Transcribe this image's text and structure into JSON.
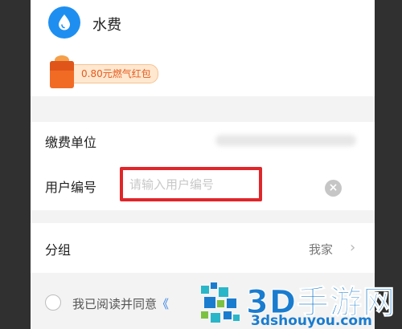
{
  "header": {
    "title": "水费",
    "app_icon": "water-drop-icon"
  },
  "promo": {
    "label": "0.80元燃气红包",
    "icon": "red-envelope-icon"
  },
  "form": {
    "unit_label": "缴费单位",
    "user_no_label": "用户编号",
    "user_no_placeholder": "请输入用户编号",
    "user_no_value": "",
    "clear_icon": "clear-icon",
    "clear_glyph": "×"
  },
  "group": {
    "label": "分组",
    "value": "我家",
    "chevron": "›"
  },
  "agreement": {
    "text": "我已阅读并同意",
    "link": "《"
  },
  "watermark": {
    "brand": "3D手游网",
    "domain": "3dshouyou.com"
  },
  "colors": {
    "accent": "#1e8ff0",
    "highlight": "#e0262a",
    "promo_text": "#e45a1e",
    "promo_bg": "#ffe8cf",
    "link": "#2f7de1",
    "watermark": "#1a7ccf"
  }
}
